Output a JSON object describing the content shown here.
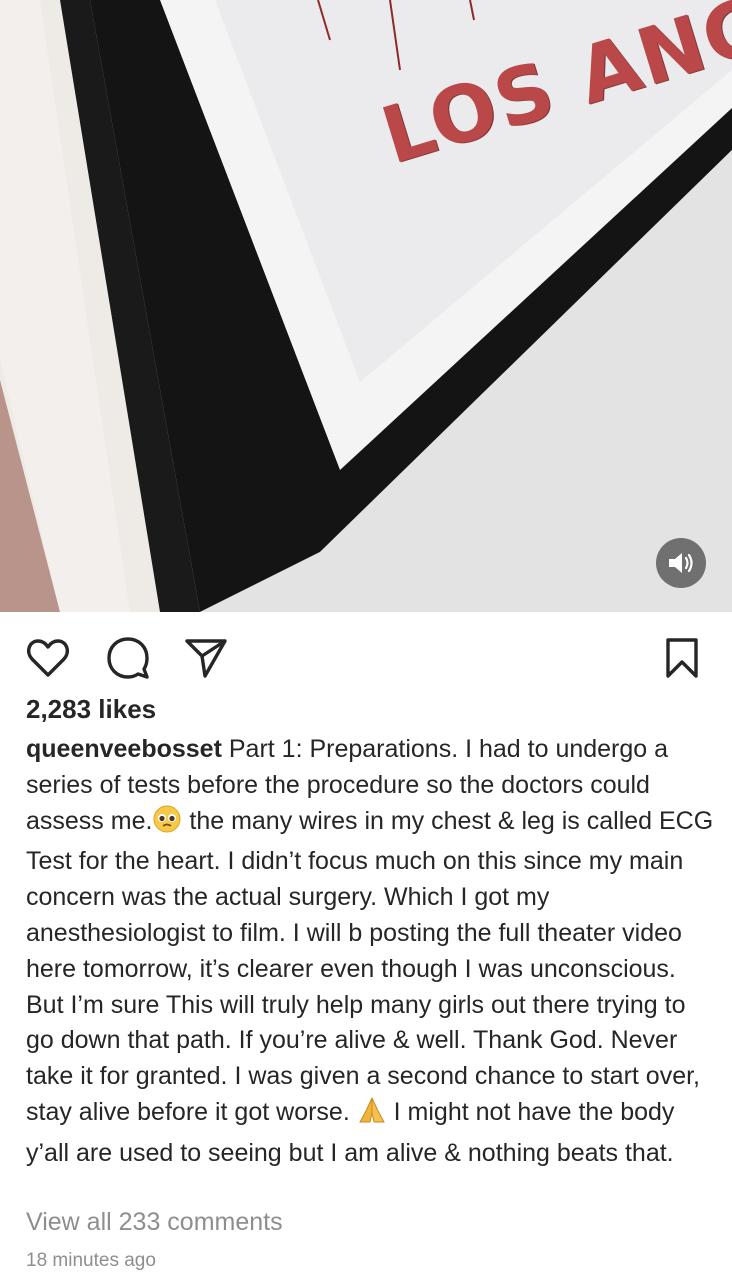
{
  "post": {
    "media": {
      "poster_text": "LOS ANGEL",
      "sound_icon": "speaker-icon"
    },
    "actions": {
      "like_icon": "heart-outline-icon",
      "comment_icon": "comment-bubble-icon",
      "share_icon": "paper-plane-icon",
      "save_icon": "bookmark-outline-icon"
    },
    "likes_text": "2,283 likes",
    "caption": {
      "username": "queenveebosset",
      "part1": " Part 1: Preparations. I had to undergo a series of tests before the procedure so the doctors could assess me.",
      "emoji1": "pleading-face-emoji",
      "part2": " the many wires in my chest & leg is called ECG Test for the heart. I didn’t focus much on this since my main concern was the actual surgery. Which I got my anesthesiologist to film. I will b posting the full theater video here tomorrow, it’s clearer even though I was unconscious. But I’m sure This will truly help many girls out there trying to go down that path.  If you’re alive & well. Thank God. Never take it for granted. I was given a second chance to start over, stay alive before it got worse. ",
      "emoji2": "folded-hands-emoji",
      "part3": " I might not have the body y’all are used to seeing but I am alive & nothing beats that."
    },
    "view_comments_text": "View all 233 comments",
    "timestamp": "18 minutes ago"
  },
  "colors": {
    "text": "#262626",
    "muted": "#8e8e8e",
    "poster_red": "#b73b3b"
  }
}
